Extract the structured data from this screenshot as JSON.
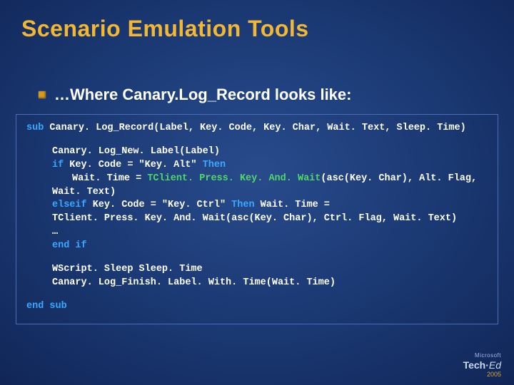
{
  "title": "Scenario Emulation Tools",
  "bullet": "…Where Canary.Log_Record looks like:",
  "code": {
    "kw_sub": "sub",
    "sig": " Canary. Log_Record(Label, Key. Code, Key. Char, Wait. Text,  Sleep. Time)",
    "l1": "Canary. Log_New. Label(Label)",
    "l2a": "if",
    "l2b": " Key. Code = \"Key. Alt\" ",
    "l2c": "Then",
    "l3a": "Wait. Time = ",
    "l3fn": "TClient. Press. Key. And. Wait",
    "l3b": "(asc(Key. Char), Alt. Flag,",
    "l3c": "Wait. Text)",
    "l4a": "elseif",
    "l4b": " Key. Code = \"Key. Ctrl\" ",
    "l4c": "Then",
    "l4d": " Wait. Time =",
    "l5": "TClient. Press. Key. And. Wait(asc(Key. Char), Ctrl. Flag, Wait. Text)",
    "l6": "…",
    "l7": "end if",
    "l8": "WScript. Sleep Sleep. Time",
    "l9": "Canary. Log_Finish. Label. With. Time(Wait. Time)",
    "end": "end sub"
  },
  "footer": {
    "ms": "Microsoft",
    "tech": "Tech·",
    "ed": "Ed",
    "year": "2005"
  }
}
